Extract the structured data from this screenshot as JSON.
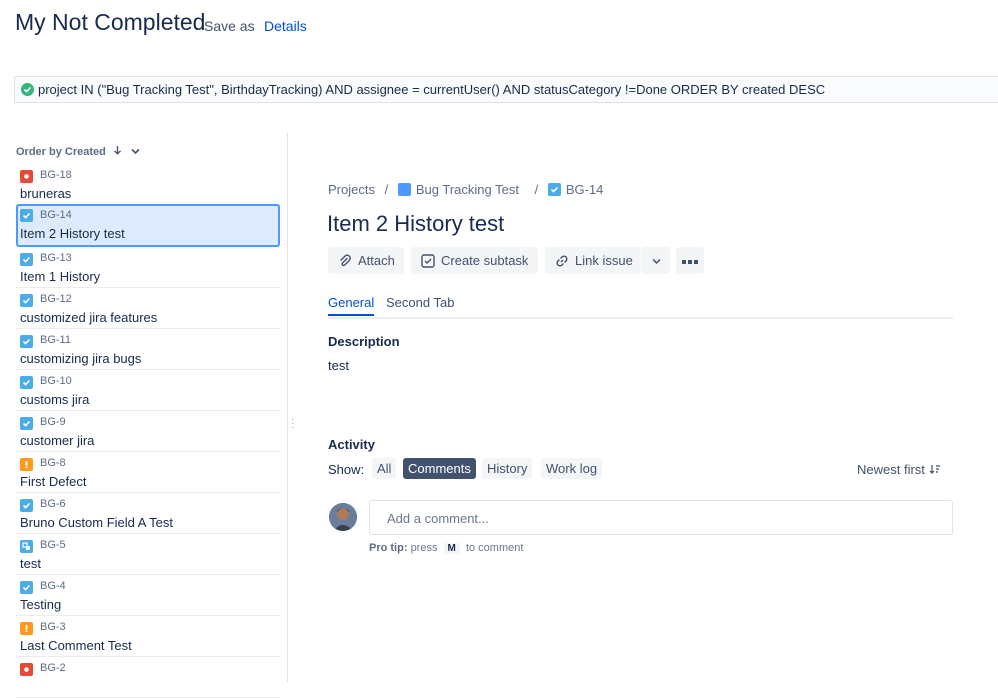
{
  "header": {
    "title": "My Not Completed",
    "save_as": "Save as",
    "details": "Details"
  },
  "jql": {
    "query": "project IN (\"Bug Tracking Test\", BirthdayTracking) AND assignee = currentUser() AND statusCategory !=Done ORDER BY created DESC",
    "status_icon": "check-circle-icon",
    "status_color": "#36b37e"
  },
  "list": {
    "order_by": "Order by Created",
    "issues": [
      {
        "key": "BG-18",
        "summary": "bruneras",
        "type": "bug"
      },
      {
        "key": "BG-14",
        "summary": "Item 2 History test",
        "type": "story",
        "selected": true
      },
      {
        "key": "BG-13",
        "summary": "Item 1 History",
        "type": "story"
      },
      {
        "key": "BG-12",
        "summary": "customized jira features",
        "type": "story"
      },
      {
        "key": "BG-11",
        "summary": "customizing jira bugs",
        "type": "story"
      },
      {
        "key": "BG-10",
        "summary": "customs jira",
        "type": "story"
      },
      {
        "key": "BG-9",
        "summary": "customer jira",
        "type": "story"
      },
      {
        "key": "BG-8",
        "summary": "First Defect",
        "type": "defect"
      },
      {
        "key": "BG-6",
        "summary": "Bruno Custom Field A Test",
        "type": "story"
      },
      {
        "key": "BG-5",
        "summary": "test",
        "type": "subtask"
      },
      {
        "key": "BG-4",
        "summary": "Testing",
        "type": "story"
      },
      {
        "key": "BG-3",
        "summary": "Last Comment Test",
        "type": "defect"
      },
      {
        "key": "BG-2",
        "summary": "",
        "type": "bug"
      }
    ]
  },
  "issue": {
    "breadcrumb": {
      "projects": "Projects",
      "project": "Bug Tracking Test",
      "key": "BG-14"
    },
    "title": "Item 2 History test",
    "buttons": {
      "attach": "Attach",
      "create_subtask": "Create subtask",
      "link_issue": "Link issue"
    },
    "tabs": {
      "general": "General",
      "second": "Second Tab"
    },
    "description_label": "Description",
    "description": "test",
    "activity": {
      "label": "Activity",
      "show": "Show:",
      "filters": {
        "all": "All",
        "comments": "Comments",
        "history": "History",
        "work_log": "Work log"
      },
      "sort": "Newest first",
      "comment_placeholder": "Add a comment...",
      "pro_tip_label": "Pro tip:",
      "pro_tip_press": "press",
      "pro_tip_key": "M",
      "pro_tip_suffix": "to comment"
    }
  },
  "colors": {
    "accent": "#0052cc",
    "selected_border": "#4c9aff",
    "story": "#4bade8",
    "bug": "#e5493a",
    "defect": "#ff991f"
  }
}
